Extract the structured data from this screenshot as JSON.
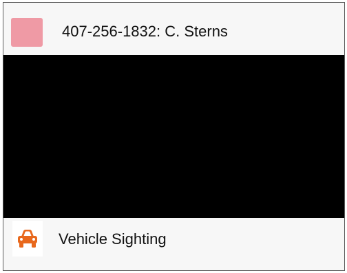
{
  "header": {
    "swatch_color": "#ef9aa5",
    "title": "407-256-1832: C. Sterns"
  },
  "media": {
    "background_color": "#000000"
  },
  "footer": {
    "icon": "car-icon",
    "icon_color": "#e8681c",
    "label": "Vehicle Sighting"
  }
}
